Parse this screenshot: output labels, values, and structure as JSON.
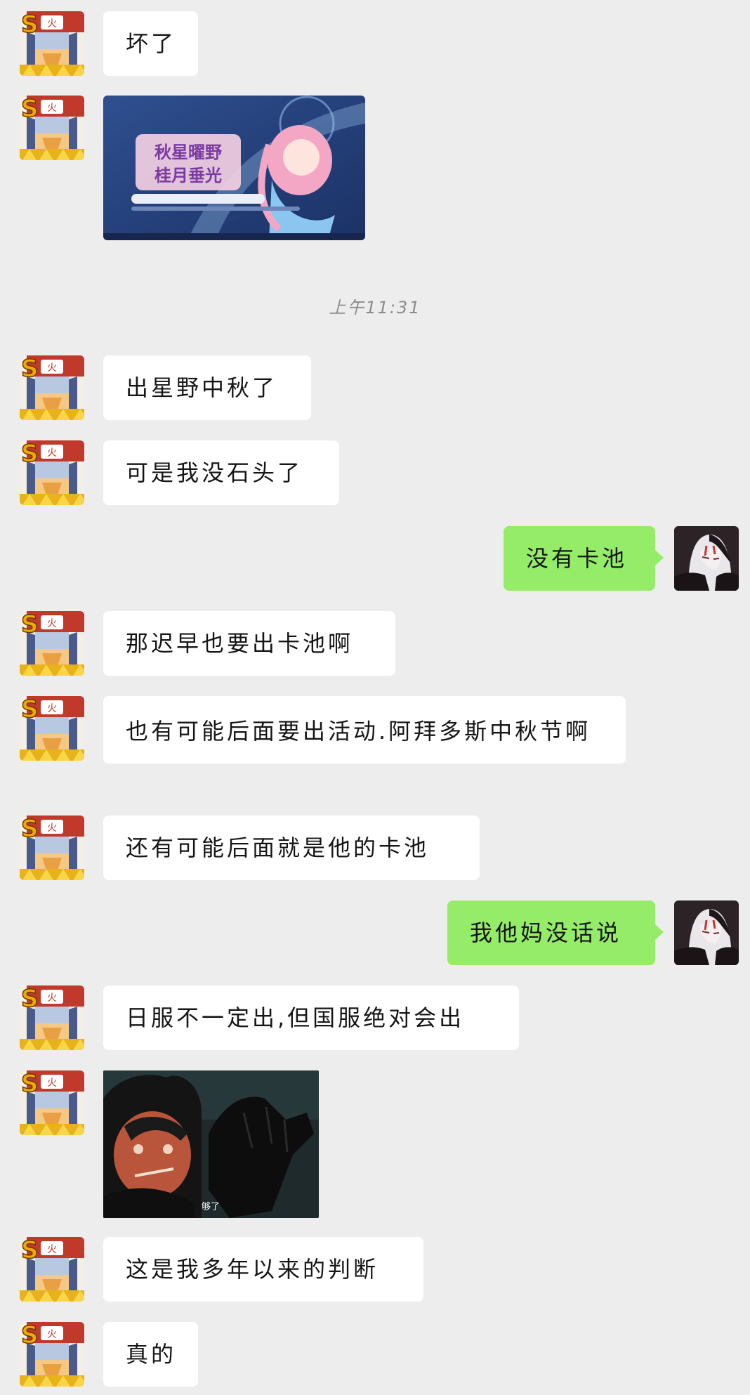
{
  "timestamp": "上午11:31",
  "colors": {
    "background": "#ededed",
    "bubble_incoming": "#ffffff",
    "bubble_outgoing": "#95ec69"
  },
  "messages": [
    {
      "type": "text",
      "side": "left",
      "text": "坏了"
    },
    {
      "type": "image",
      "side": "left",
      "image_text": {
        "title_line1": "秋星曜野",
        "title_line2": "桂月垂光"
      }
    },
    {
      "type": "text",
      "side": "left",
      "text": "出星野中秋了"
    },
    {
      "type": "text",
      "side": "left",
      "text": "可是我没石头了"
    },
    {
      "type": "text",
      "side": "right",
      "text": "没有卡池"
    },
    {
      "type": "text",
      "side": "left",
      "text": "那迟早也要出卡池啊"
    },
    {
      "type": "text",
      "side": "left",
      "text": "也有可能后面要出活动.阿拜多斯中秋节啊"
    },
    {
      "type": "text",
      "side": "left",
      "text": "还有可能后面就是他的卡池"
    },
    {
      "type": "text",
      "side": "right",
      "text": "我他妈没话说"
    },
    {
      "type": "text",
      "side": "left",
      "text": "日服不一定出,但国服绝对会出"
    },
    {
      "type": "image",
      "side": "left",
      "image_text": {
        "caption": "够了"
      }
    },
    {
      "type": "text",
      "side": "left",
      "text": "这是我多年以来的判断"
    },
    {
      "type": "text",
      "side": "left",
      "text": "真的"
    }
  ]
}
